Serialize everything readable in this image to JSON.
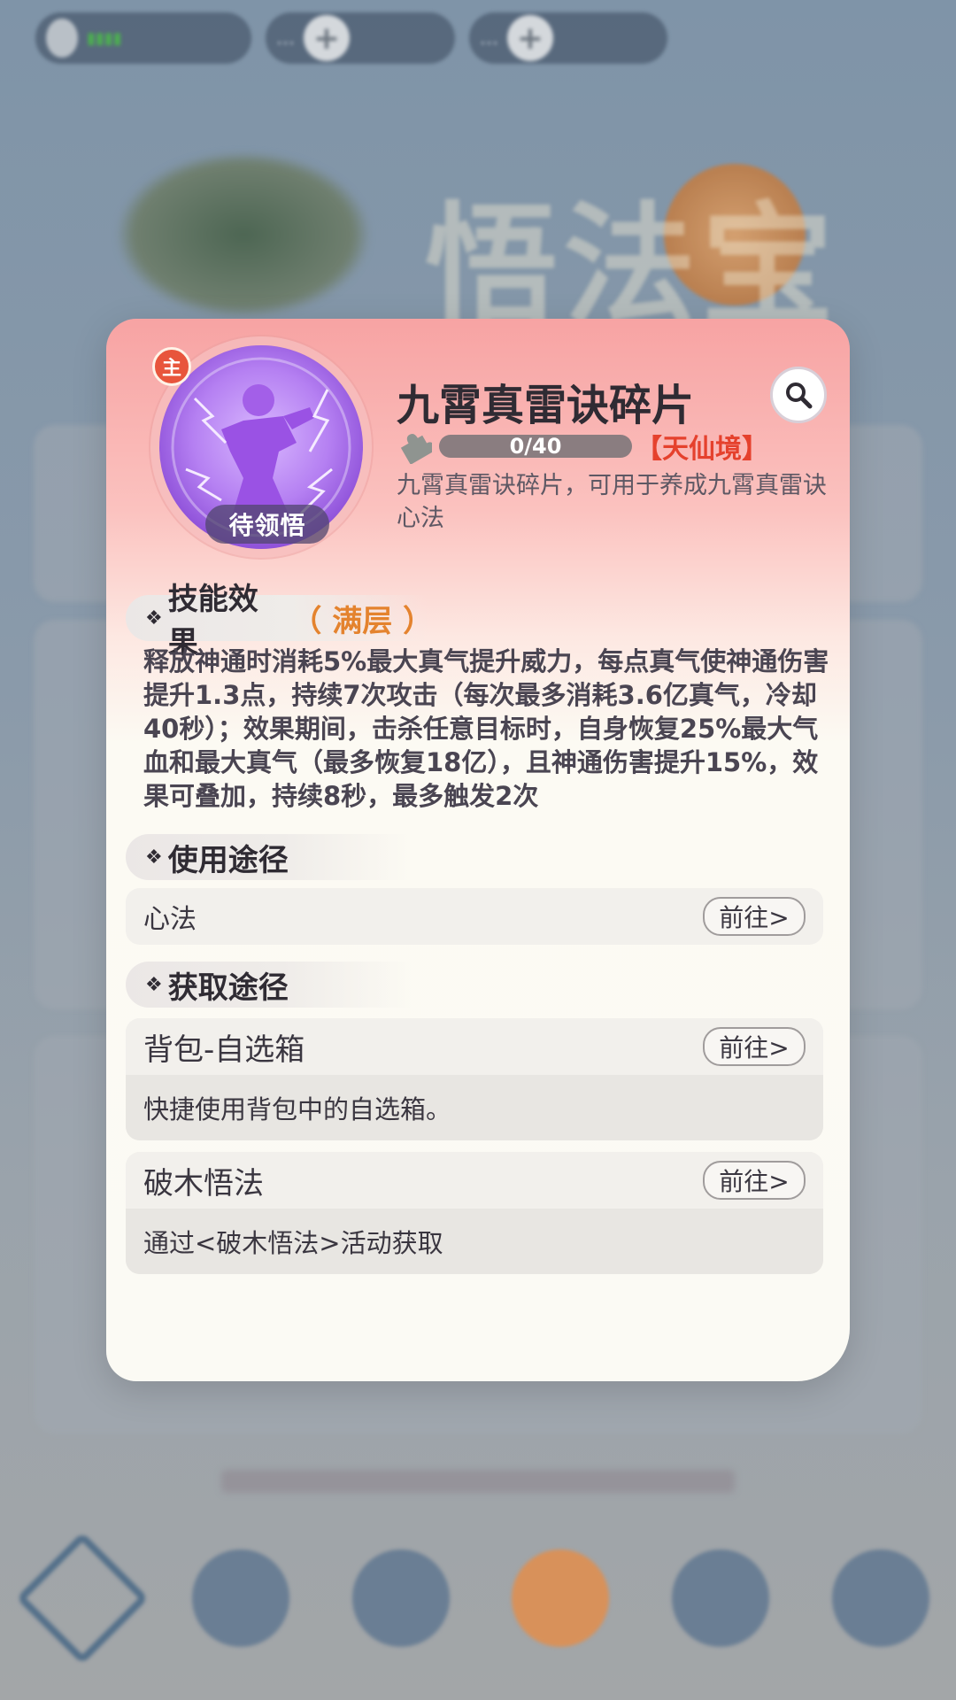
{
  "background": {
    "currency_1_value": "...",
    "currency_2_value": "...",
    "banner_title": "悟法宝物"
  },
  "modal": {
    "main_badge": "主",
    "pending_tag": "待领悟",
    "title": "九霄真雷诀碎片",
    "fragment_progress": "0/40",
    "fragment_progress_fraction": 0.0,
    "realm": "【天仙境】",
    "description": "九霄真雷诀碎片，可用于养成九霄真雷诀心法",
    "skill_effect": {
      "heading": "技能效果",
      "level": "（ 满层 ）",
      "text": "释放神通时消耗5%最大真气提升威力，每点真气使神通伤害提升1.3点，持续7次攻击（每次最多消耗3.6亿真气，冷却40秒）；效果期间，击杀任意目标时，自身恢复25%最大气血和最大真气（最多恢复18亿），且神通伤害提升15%，效果可叠加，持续8秒，最多触发2次"
    },
    "usage": {
      "heading": "使用途径",
      "items": [
        {
          "label": "心法",
          "button": "前往>"
        }
      ]
    },
    "acquire": {
      "heading": "获取途径",
      "items": [
        {
          "label": "背包-自选箱",
          "button": "前往>",
          "desc": "快捷使用背包中的自选箱。"
        },
        {
          "label": "破木悟法",
          "button": "前往>",
          "desc": "通过<破木悟法>活动获取"
        }
      ]
    },
    "colors": {
      "header_top": "#f7a3a3",
      "accent_orange": "#e4832e",
      "realm_red": "#e5412d",
      "skill_purple": "#b580f2"
    },
    "icons": {
      "search": "search-icon",
      "fragment": "puzzle-piece-icon"
    }
  }
}
